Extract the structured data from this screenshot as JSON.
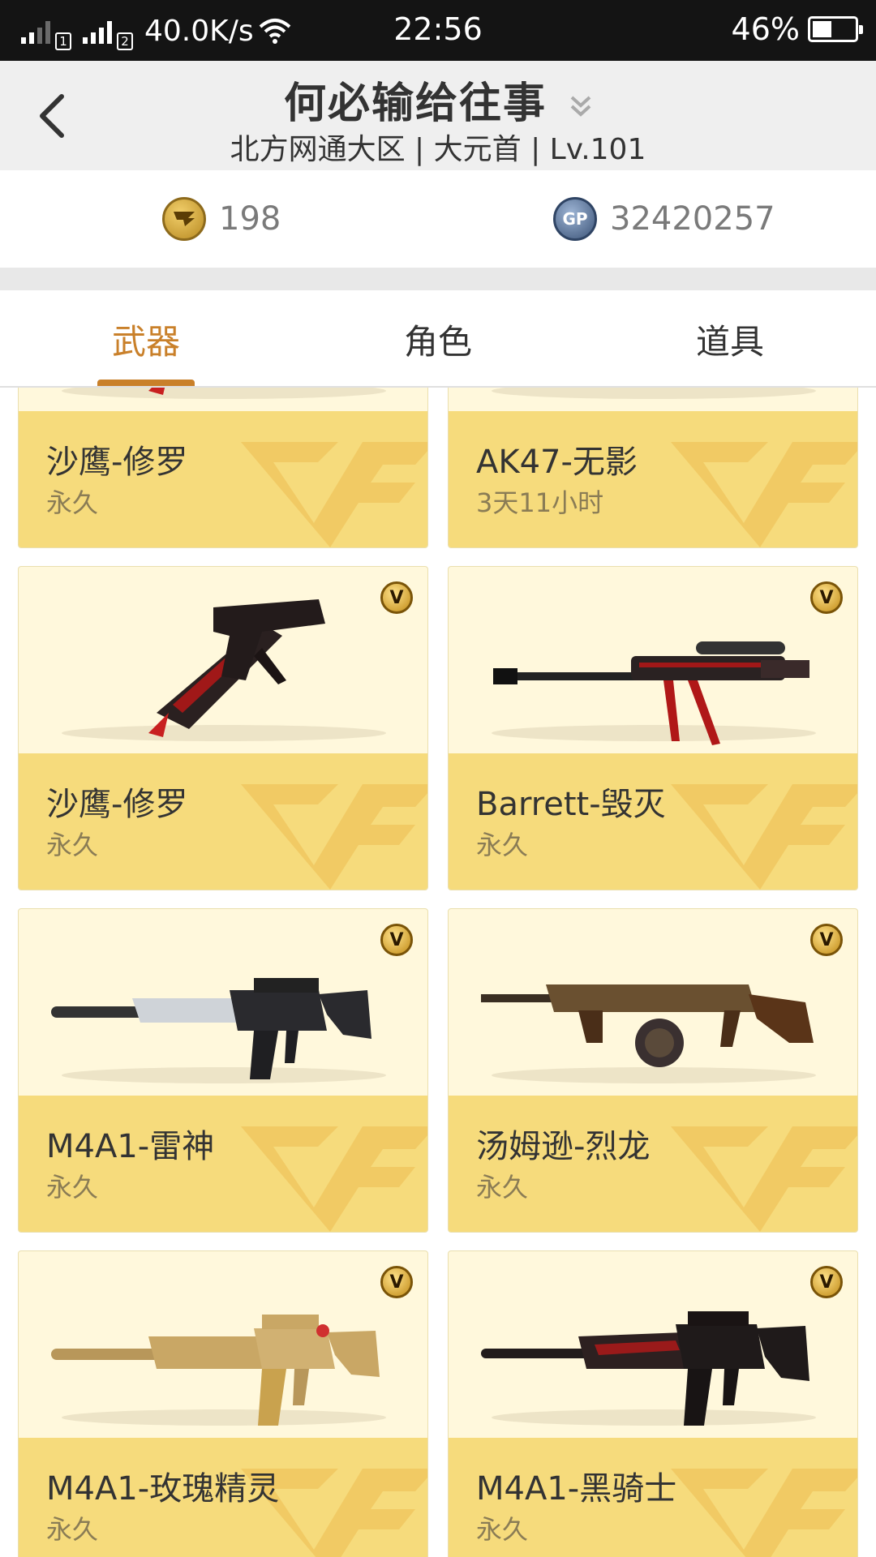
{
  "status_bar": {
    "sim1": "1",
    "sim2": "2",
    "speed": "40.0K/s",
    "time": "22:56",
    "battery_percent": "46%",
    "battery_level": 0.46
  },
  "header": {
    "title": "何必输给往事",
    "subtitle": "北方网通大区 | 大元首 | Lv.101"
  },
  "currency": {
    "cf_coins": "198",
    "cf_icon": "cf-coin-icon",
    "gp": "32420257",
    "gp_icon": "gp-coin-icon",
    "gp_icon_text": "GP"
  },
  "tabs": [
    {
      "label": "武器",
      "active": true
    },
    {
      "label": "角色",
      "active": false
    },
    {
      "label": "道具",
      "active": false
    }
  ],
  "items": [
    {
      "name": "沙鹰-修罗",
      "duration": "永久",
      "vip": false,
      "weapon": "pistol"
    },
    {
      "name": "AK47-无影",
      "duration": "3天11小时",
      "vip": false,
      "weapon": "rifle"
    },
    {
      "name": "沙鹰-修罗",
      "duration": "永久",
      "vip": true,
      "weapon": "pistol"
    },
    {
      "name": "Barrett-毁灭",
      "duration": "永久",
      "vip": true,
      "weapon": "sniper"
    },
    {
      "name": "M4A1-雷神",
      "duration": "永久",
      "vip": true,
      "weapon": "m4"
    },
    {
      "name": "汤姆逊-烈龙",
      "duration": "永久",
      "vip": true,
      "weapon": "thompson"
    },
    {
      "name": "M4A1-玫瑰精灵",
      "duration": "永久",
      "vip": true,
      "weapon": "m4-gold"
    },
    {
      "name": "M4A1-黑骑士",
      "duration": "永久",
      "vip": true,
      "weapon": "m4-dark"
    }
  ],
  "vip_badge_text": "V",
  "colors": {
    "accent": "#c9802a",
    "card_bg": "#fff8dc",
    "label_bg": "#f6db7c",
    "status_bar": "#141414",
    "header_bg": "#efefef"
  }
}
